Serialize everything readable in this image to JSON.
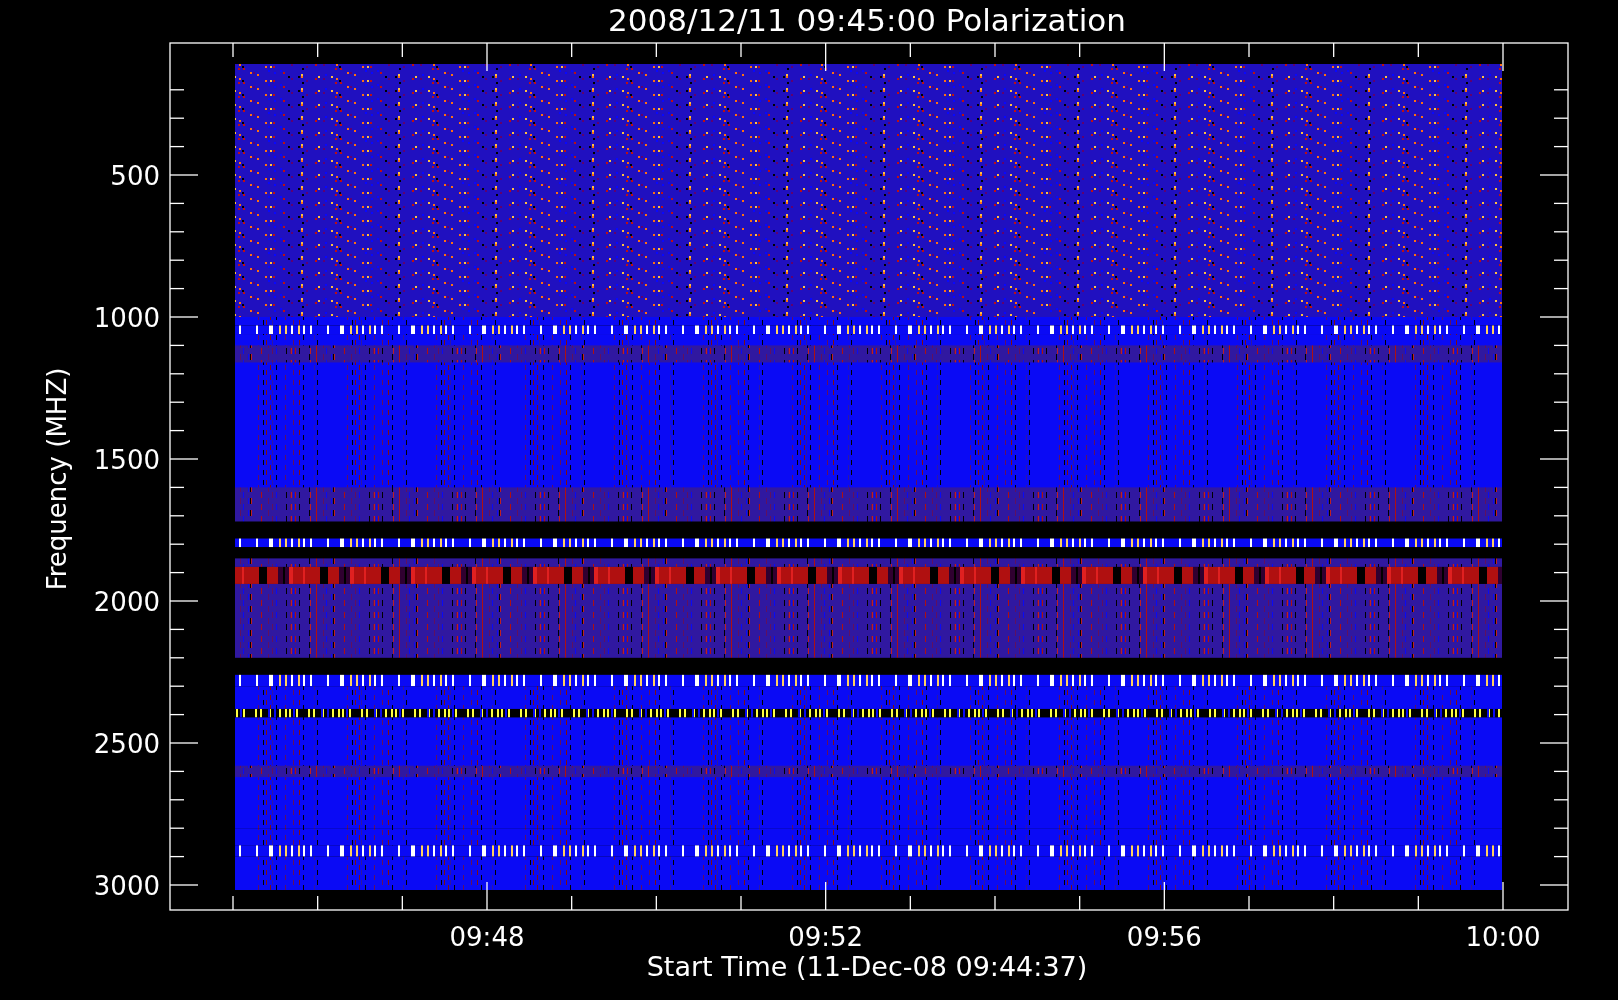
{
  "plot": {
    "title": "2008/12/11 09:45:00 Polarization",
    "ylabel": "Frequency (MHZ)",
    "xlabel": "Start Time (11-Dec-08 09:44:37)",
    "yticks": [
      "500",
      "1000",
      "1500",
      "2000",
      "2500",
      "3000"
    ],
    "xticks": [
      "09:48",
      "09:52",
      "09:56",
      "10:00"
    ]
  }
}
